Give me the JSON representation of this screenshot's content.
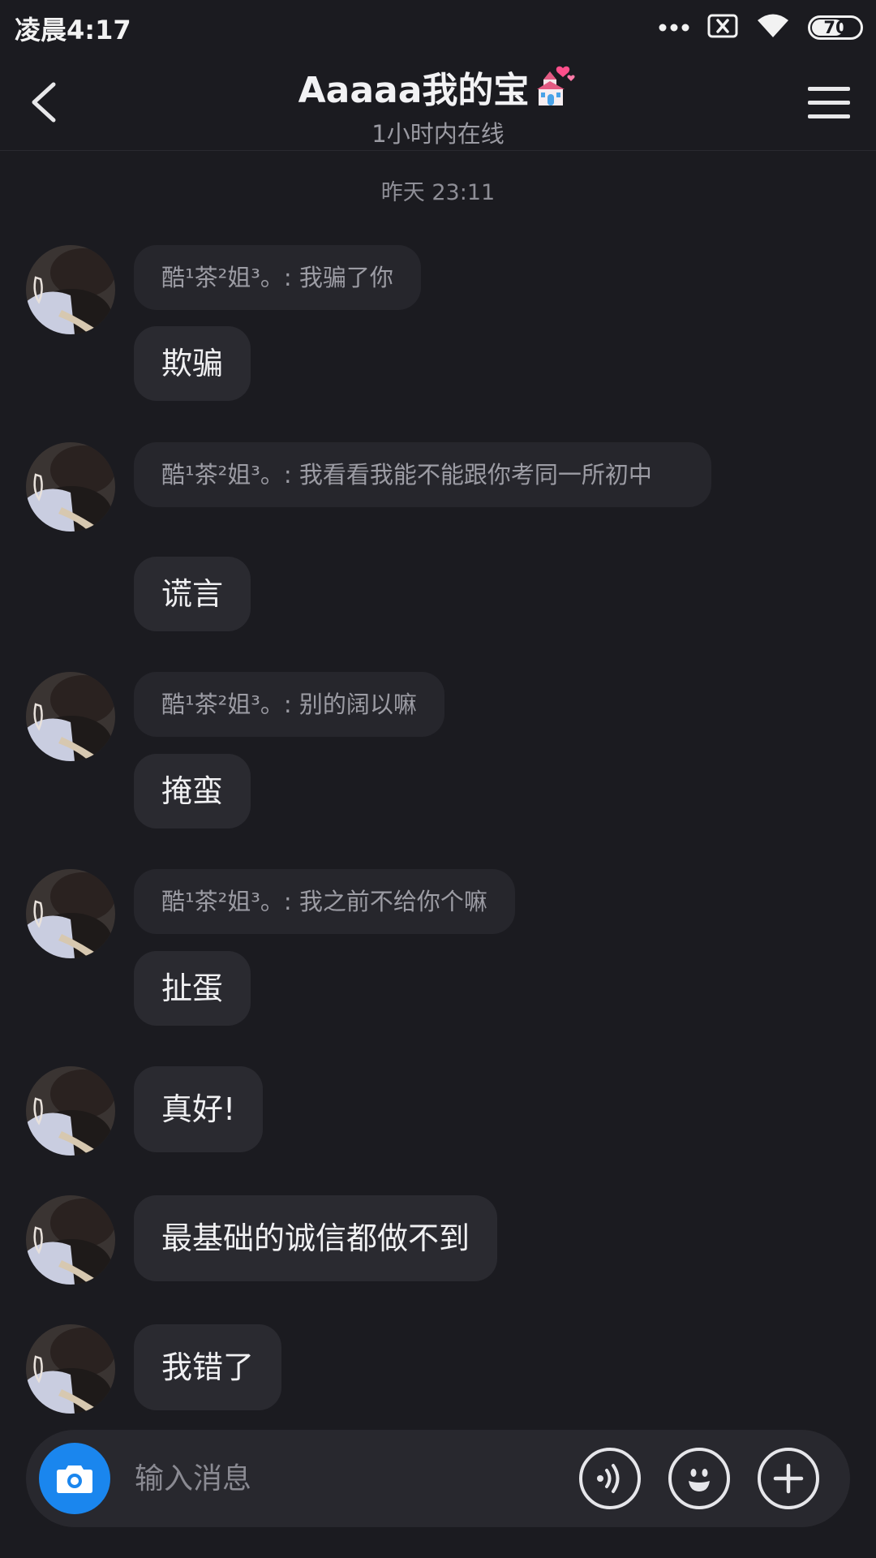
{
  "status_bar": {
    "time": "凌晨4:17",
    "battery": "70",
    "battery_level": 0.7,
    "icons": [
      "more-dots-icon",
      "no-sim-icon",
      "wifi-icon",
      "battery-icon"
    ]
  },
  "header": {
    "title": "Aaaaa我的宝",
    "title_icon": "wedding-chapel-emoji",
    "subtitle": "1小时内在线",
    "back_icon": "chevron-left-icon",
    "menu_icon": "hamburger-menu-icon"
  },
  "messages": {
    "date": "昨天 23:11",
    "items": [
      {
        "quote": "酷¹茶²姐³。: 我骗了你",
        "text": "欺骗"
      },
      {
        "quote": "酷¹茶²姐³。: 我看看我能不能跟你考同一所初中",
        "text": "谎言"
      },
      {
        "quote": "酷¹茶²姐³。: 别的阔以嘛",
        "text": "掩蛮"
      },
      {
        "quote": "酷¹茶²姐³。: 我之前不给你个嘛",
        "text": "扯蛋"
      },
      {
        "text": "真好!"
      },
      {
        "text": "最基础的诚信都做不到"
      },
      {
        "text": "我错了"
      }
    ]
  },
  "input_bar": {
    "placeholder": "输入消息",
    "camera_icon": "camera-icon",
    "voice_icon": "voice-icon",
    "emoji_icon": "emoji-icon",
    "plus_icon": "plus-icon",
    "accent_color": "#1a86ee"
  }
}
